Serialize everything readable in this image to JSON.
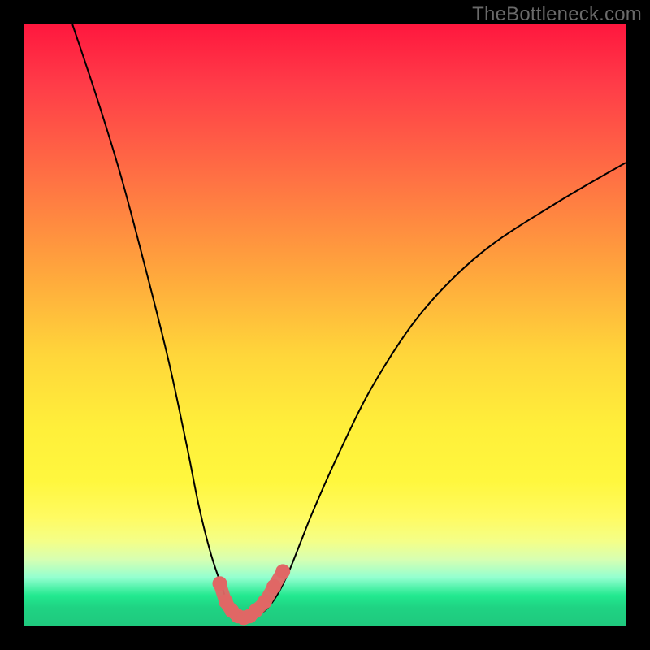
{
  "watermark": "TheBottleneck.com",
  "chart_data": {
    "type": "line",
    "title": "",
    "xlabel": "",
    "ylabel": "",
    "xlim": [
      0,
      100
    ],
    "ylim": [
      0,
      100
    ],
    "series": [
      {
        "name": "bottleneck-curve",
        "x": [
          8,
          12,
          16,
          20,
          24,
          27,
          29,
          31,
          33,
          34,
          35,
          36.5,
          38,
          40,
          42,
          44,
          46,
          48,
          52,
          58,
          66,
          76,
          88,
          100
        ],
        "values": [
          100,
          88,
          75,
          60,
          44,
          30,
          20,
          12,
          6,
          3,
          1.5,
          1,
          1.5,
          2.5,
          5,
          9,
          14,
          19,
          28,
          40,
          52,
          62,
          70,
          77
        ]
      },
      {
        "name": "trough-highlight",
        "x": [
          32.5,
          33.5,
          34.5,
          35.5,
          36.5,
          37.5,
          38.5,
          40,
          41.5,
          43
        ],
        "values": [
          7,
          4,
          2.5,
          1.6,
          1.3,
          1.6,
          2.5,
          4,
          6.5,
          9
        ]
      }
    ],
    "colors": {
      "curve": "#000000",
      "highlight": "#e06765",
      "background_top": "#ff173e",
      "background_bottom": "#1fc97e"
    }
  }
}
